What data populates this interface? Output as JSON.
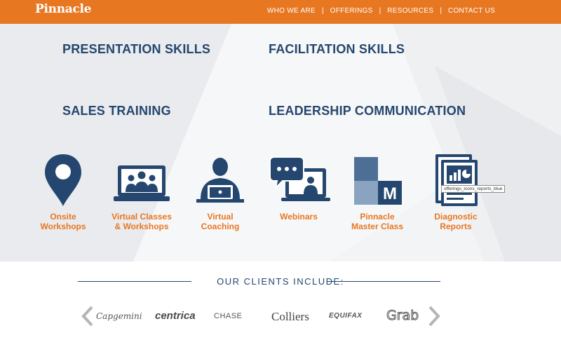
{
  "header": {
    "logo": "Pinnacle",
    "nav": [
      "WHO WE ARE",
      "OFFERINGS",
      "RESOURCES",
      "CONTACT US"
    ],
    "brand_color": "#e87722"
  },
  "skills": [
    "PRESENTATION SKILLS",
    "FACILITATION SKILLS",
    "SALES TRAINING",
    "LEADERSHIP COMMUNICATION"
  ],
  "offerings": [
    {
      "line1": "Onsite",
      "line2": "Workshops",
      "icon": "map-pin-icon"
    },
    {
      "line1": "Virtual Classes",
      "line2": "& Workshops",
      "icon": "virtual-class-laptop-icon"
    },
    {
      "line1": "Virtual",
      "line2": "Coaching",
      "icon": "coaching-person-laptop-icon"
    },
    {
      "line1": "Webinars",
      "line2": "",
      "icon": "webinar-chat-monitor-icon"
    },
    {
      "line1": "Pinnacle",
      "line2": "Master Class",
      "icon": "master-class-m-icon"
    },
    {
      "line1": "Diagnostic",
      "line2": "Reports",
      "icon": "reports-chart-icon"
    }
  ],
  "tooltip": "offerings_icons_reports_blue",
  "clients": {
    "title": "OUR CLIENTS INCLUDE:",
    "logos": [
      "Capgemini",
      "centrica",
      "CHASE",
      "Colliers",
      "EQUIFAX",
      "Grab"
    ]
  },
  "colors": {
    "navy": "#25476f",
    "orange": "#e87722",
    "mid_blue": "#4e6f95",
    "light_blue": "#8aa3c1"
  }
}
